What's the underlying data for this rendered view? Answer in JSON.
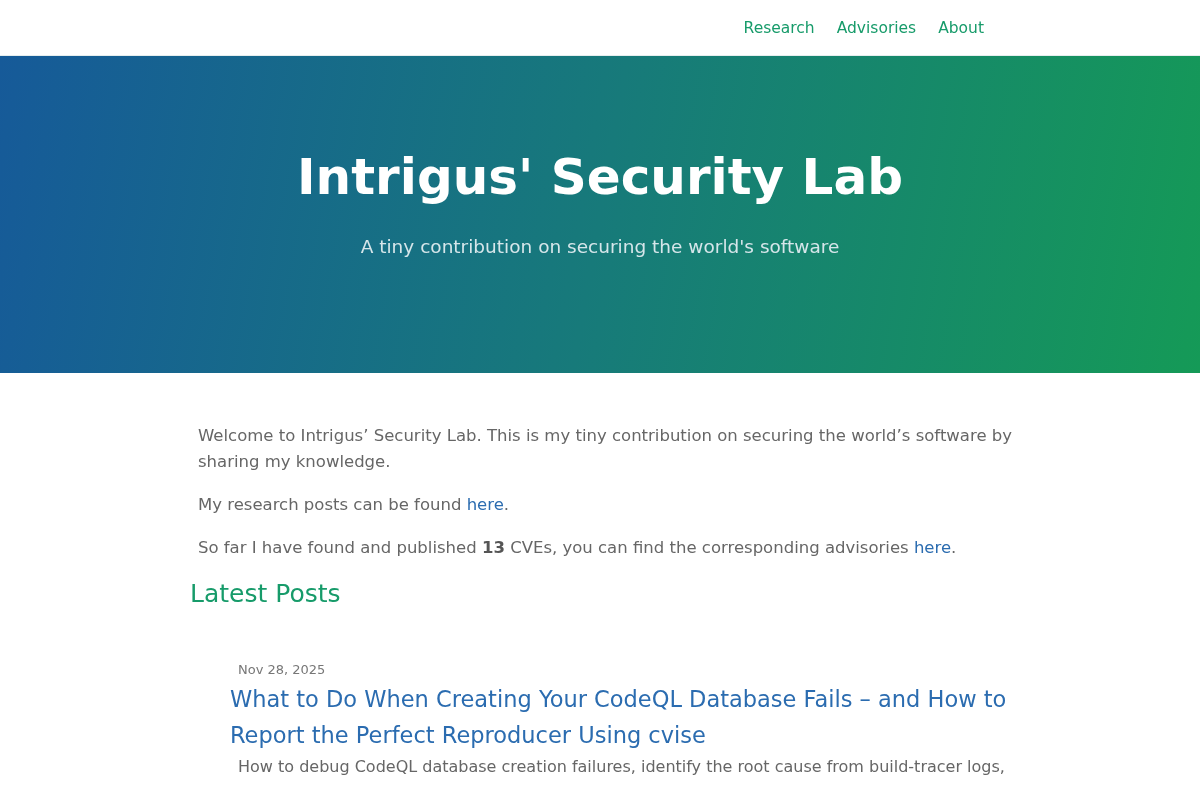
{
  "nav": {
    "links": [
      "Research",
      "Advisories",
      "About"
    ]
  },
  "hero": {
    "title": "Intrigus' Security Lab",
    "subtitle": "A tiny contribution on securing the world's software"
  },
  "intro": [
    {
      "before": "Welcome to Intrigus’ Security Lab. This is my tiny contribution on securing the world’s software by sharing my knowledge."
    },
    {
      "before": "My research posts can be found ",
      "link": "here",
      "after": "."
    },
    {
      "before": "So far I have found and published **13** CVEs, you can find the corresponding advisories ",
      "link": "here",
      "after": "."
    }
  ],
  "latest": {
    "heading": "Latest Posts",
    "posts": [
      {
        "date": "Nov 28, 2025",
        "title": "What to Do When Creating Your CodeQL Database Fails – and How to Report the Perfect Reproducer Using cvise",
        "excerpt": "How to debug CodeQL database creation failures, identify the root cause from build-tracer logs,"
      }
    ]
  }
}
